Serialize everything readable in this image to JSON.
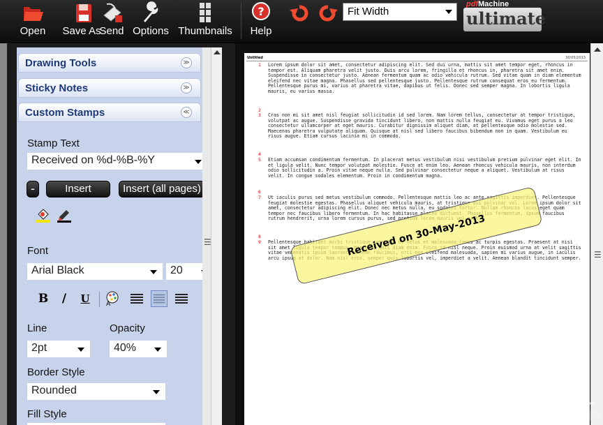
{
  "toolbar": {
    "open": "Open",
    "save_as": "Save As",
    "send": "Send",
    "options": "Options",
    "thumbnails": "Thumbnails",
    "help": "Help",
    "zoom_value": "Fit Width",
    "icons": [
      "open-folder-icon",
      "floppy-disk-icon",
      "send-mail-icon",
      "wrench-icon",
      "thumbnails-icon",
      "help-icon",
      "rotate-left-icon",
      "rotate-right-icon"
    ]
  },
  "logo": {
    "pdf": "pdf",
    "machine": "Machine",
    "ultimate": "ultimate"
  },
  "panel": {
    "drawing_tools": "Drawing Tools",
    "sticky_notes": "Sticky Notes",
    "custom_stamps": "Custom Stamps",
    "stamp_text_label": "Stamp Text",
    "stamp_text_value": "Received on %d-%B-%Y",
    "insert": "Insert",
    "insert_all": "Insert (all pages)",
    "font_label": "Font",
    "font_value": "Arial Black",
    "font_size": "20",
    "line_label": "Line",
    "line_value": "2pt",
    "opacity_label": "Opacity",
    "opacity_value": "40%",
    "border_style_label": "Border Style",
    "border_style_value": "Rounded",
    "fill_style_label": "Fill Style",
    "bold": "B",
    "italic": "/",
    "underline": "U"
  },
  "document": {
    "title": "Untitled",
    "date": "30/05/2013",
    "stamp_text": "Received on 30-May-2013",
    "paragraphs": [
      {
        "num": "1",
        "text": "Lorem ipsum dolor sit amet, consectetur adipiscing elit. Sed dui urna, mattis sit amet tempor eget, rhoncus in tempor est. Aliquam pharetra velit justo. Duis arcu lorem, fringilla et rhoncus in, pharetra sit amet enim. Suspendisse in consectetur justo. Aenean fermentum quam ac odio vehicula rutrum. Sed vitae quam in diam elementum eleifend nec vitae magna. Phasellus sed pellentesque justo. Pellentesque rutrum consequat eros eu fermentum. Pellentesque purus mi, varius at pharetra vitae, dapibus ut felis. Donec sed semper magna. In lobortis ligula mauris, eu varius massa."
      },
      {
        "num": "2",
        "text": ""
      },
      {
        "num": "3",
        "text": "Cras non mi sit amet nisl feugiat sollicitudin id sed lorem. Nam lorem tellus, consectetur at tempor tristique, volutpat ac augue. Suspendisse gravida tincidunt libero, non mattis nulla feugiat eu. Vivamus eget purus a leo consectetur ullamcorper at eget mauris. Curabitur dignissim aliquet diam, at pellentesque odio molestie sed. Maecenas pharetra vulputate aliquam. Quisque at nisl sed libero faucibus bibendum non in quam. Vestibulum eu risus augue. Etiam cursus lacinia mi in commodo."
      },
      {
        "num": "4",
        "text": ""
      },
      {
        "num": "5",
        "text": "Etiam accumsan condimentum fermentum. In placerat metus vestibulum nisi vestibulum pretium pulvinar eget elit. In et ligula velit. Nunc tempor volutpat molestie. Fusce at enim leo. Aenean rhoncus vehicula mauris, non interdum odio sollicitudin a. Proin vitae neque nulla. Sed pulvinar consectetur neque a aliquet. Vestibulum at risus velit. In congue sodales elementum. Proin in condimentum magna."
      },
      {
        "num": "6",
        "text": ""
      },
      {
        "num": "7",
        "text": "Ut iaculis purus sed metus vestibulum commodo. Pellentesque mattis leo ac ante sagittis imperdiet. Pellentesque feugiat molestie egestas. Phasellus aliquet vehicula mauris, at tristique dui pulvinar vel. Lorem ipsum dolor sit amet, consectetur adipiscing elit. Donec nec metus nulla, eu sodales tortor. Nullam rhoncus lacus eget quam tempor nec faucibus libero fermentum. In hac habitasse platea dictumst. Phasellus fermentum, ipsum faucibus rutrum hendrerit, urna lorem cursus purus, sed pretium lorem mauris vel nibh."
      },
      {
        "num": "8",
        "text": ""
      },
      {
        "num": "9",
        "text": "Pellentesque habitant morbi tristique senectus et netus et malesuada fames ac turpis egestas. Praesent at nisi sit amet ligula tempor tempus. Maecenas quis diam enim. Fusce id nisl neque. Proin euismod urna at velit sagittis vitae venenatis ipsum laoreet. Aenean faucibus, orci non eleifend malesuada, sapien mi varius augue, in iaculis arcu ipsum at dolor. Nam nisl eros, semper quis lobortis vel, imperdiet a velit. Aenean blandit tincidunt semper."
      }
    ]
  },
  "colors": {
    "panel_bg": "#c7d3ea",
    "header_text": "#1f3a7a",
    "stamp_fill": "#faf478",
    "accent_red": "#e23b2a"
  }
}
